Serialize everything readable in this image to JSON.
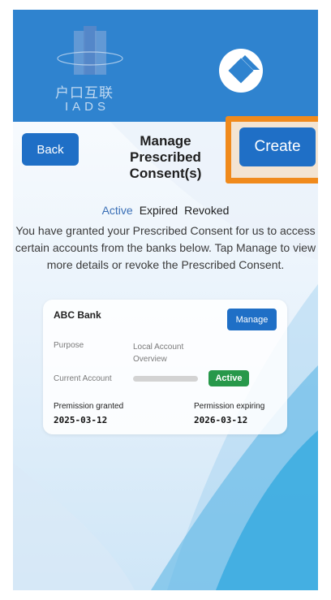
{
  "header": {
    "logo_text_cn": "户口互联",
    "logo_text_en": "IADS"
  },
  "toolbar": {
    "back_label": "Back",
    "title": "Manage Prescribed Consent(s)",
    "create_label": "Create"
  },
  "tabs": [
    {
      "label": "Active",
      "selected": true
    },
    {
      "label": "Expired",
      "selected": false
    },
    {
      "label": "Revoked",
      "selected": false
    }
  ],
  "description": "You have granted your Prescribed Consent for us to access certain accounts from the banks below. Tap Manage to view more details or revoke the Prescribed Consent.",
  "consent_card": {
    "bank_name": "ABC Bank",
    "manage_label": "Manage",
    "purpose_label": "Purpose",
    "purpose_value": "Local Account Overview",
    "account_label": "Current Account",
    "status": "Active",
    "granted_label": "Premission granted",
    "granted_date": "2025-03-12",
    "expiring_label": "Permission expiring",
    "expiring_date": "2026-03-12"
  },
  "colors": {
    "header_bg": "#2f83cf",
    "primary_button": "#1f6fc6",
    "highlight_border": "#f08a1c",
    "status_active": "#27984a",
    "tab_active": "#3a6fb6"
  },
  "icons": {
    "app_logo": "iads-logo-icon",
    "bank_logo": "bank-logo-icon"
  }
}
